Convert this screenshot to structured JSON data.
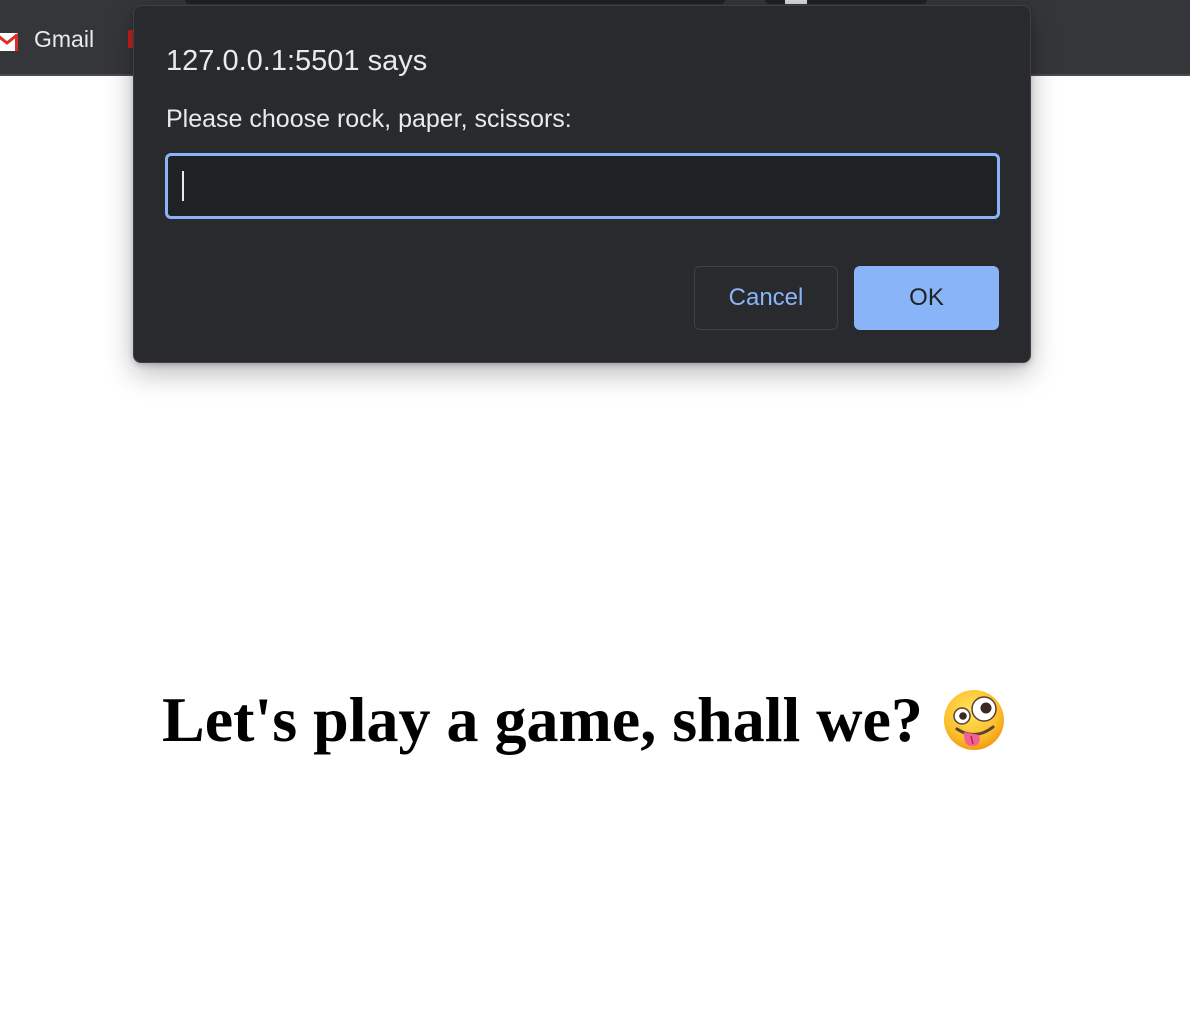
{
  "browser": {
    "bookmarks": [
      {
        "label": "Gmail",
        "icon": "gmail-icon"
      }
    ]
  },
  "dialog": {
    "title": "127.0.0.1:5501 says",
    "message": "Please choose rock, paper, scissors:",
    "input_value": "",
    "cancel_label": "Cancel",
    "ok_label": "OK"
  },
  "page": {
    "heading": "Let's play a game, shall we?",
    "emoji_icon": "zany-face-icon"
  },
  "colors": {
    "dialog_bg": "#292a2d",
    "accent": "#8ab4f8",
    "toolbar_bg": "#35363a"
  }
}
